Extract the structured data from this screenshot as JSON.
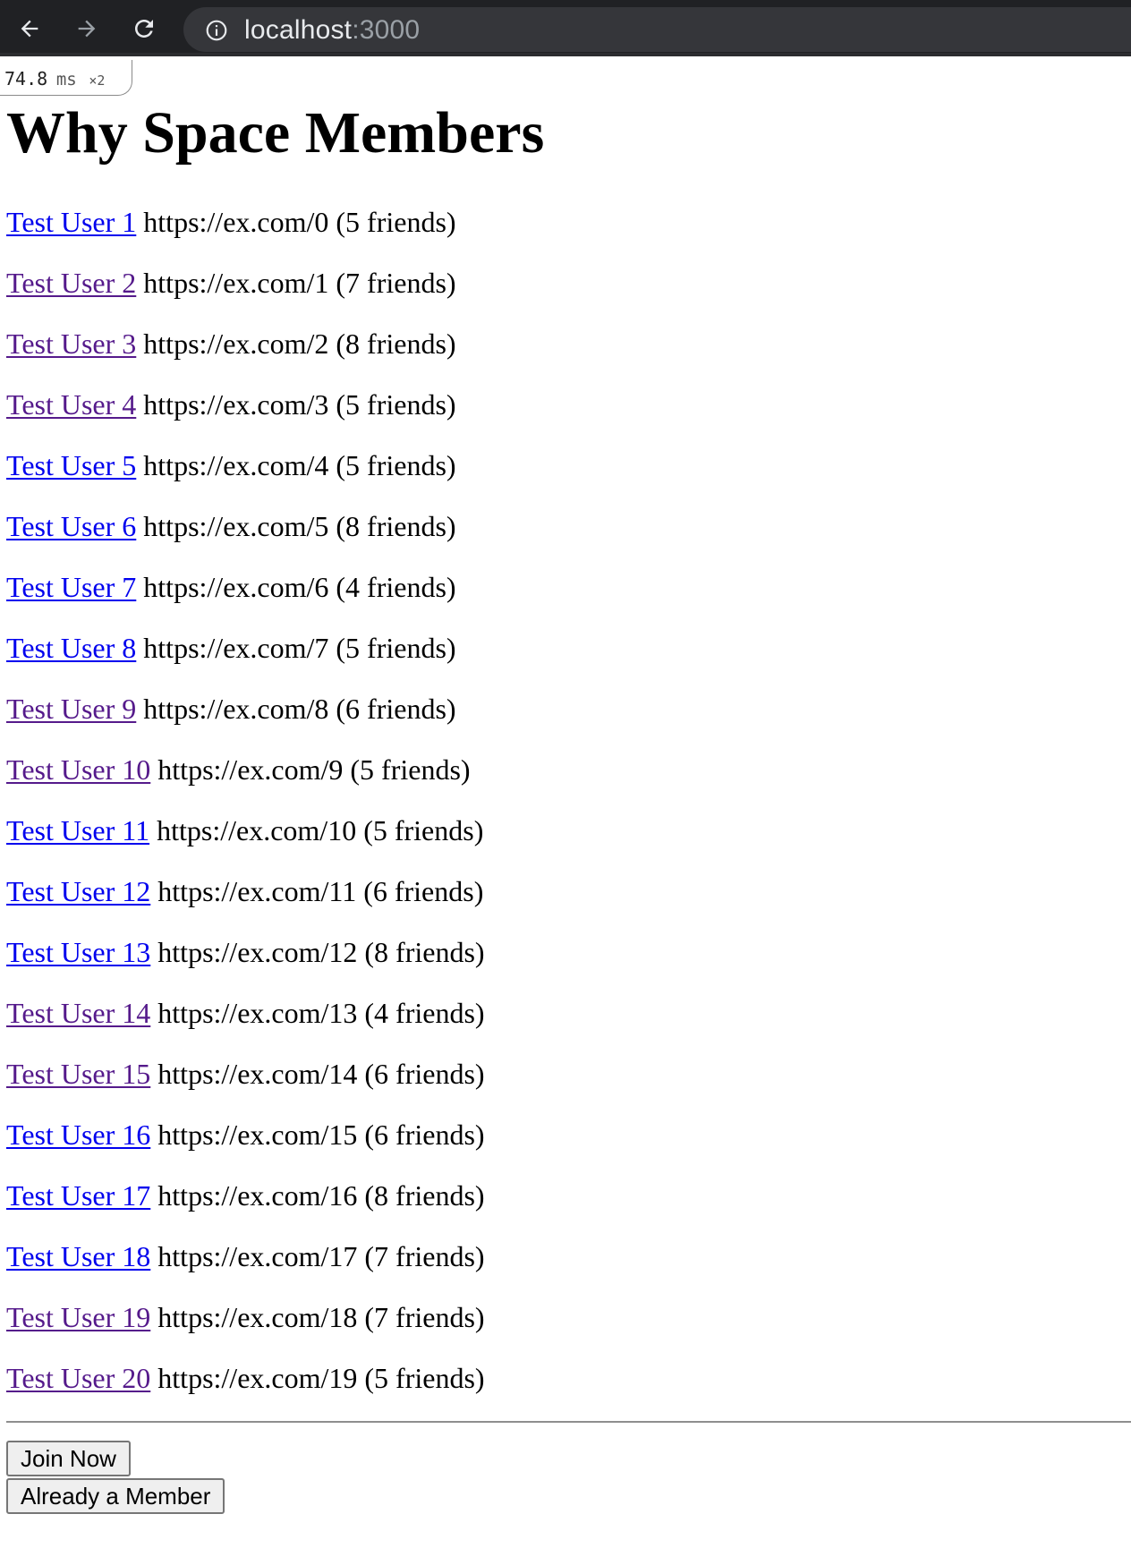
{
  "browser": {
    "url_host": "localhost",
    "url_port": ":3000",
    "icons": {
      "back": "arrow-left-icon",
      "forward": "arrow-right-icon",
      "reload": "reload-icon",
      "info": "info-circle-icon"
    }
  },
  "timing": {
    "value": "74.8",
    "unit": "ms",
    "multiplier": "×2"
  },
  "page": {
    "title": "Why Space Members"
  },
  "members": [
    {
      "name": "Test User 1",
      "url": "https://ex.com/0",
      "friends": "(5 friends)",
      "visited": false
    },
    {
      "name": "Test User 2",
      "url": "https://ex.com/1",
      "friends": "(7 friends)",
      "visited": true
    },
    {
      "name": "Test User 3",
      "url": "https://ex.com/2",
      "friends": "(8 friends)",
      "visited": true
    },
    {
      "name": "Test User 4",
      "url": "https://ex.com/3",
      "friends": "(5 friends)",
      "visited": true
    },
    {
      "name": "Test User 5",
      "url": "https://ex.com/4",
      "friends": "(5 friends)",
      "visited": false
    },
    {
      "name": "Test User 6",
      "url": "https://ex.com/5",
      "friends": "(8 friends)",
      "visited": false
    },
    {
      "name": "Test User 7",
      "url": "https://ex.com/6",
      "friends": "(4 friends)",
      "visited": false
    },
    {
      "name": "Test User 8",
      "url": "https://ex.com/7",
      "friends": "(5 friends)",
      "visited": false
    },
    {
      "name": "Test User 9",
      "url": "https://ex.com/8",
      "friends": "(6 friends)",
      "visited": true
    },
    {
      "name": "Test User 10",
      "url": "https://ex.com/9",
      "friends": "(5 friends)",
      "visited": true
    },
    {
      "name": "Test User 11",
      "url": "https://ex.com/10",
      "friends": "(5 friends)",
      "visited": false
    },
    {
      "name": "Test User 12",
      "url": "https://ex.com/11",
      "friends": "(6 friends)",
      "visited": false
    },
    {
      "name": "Test User 13",
      "url": "https://ex.com/12",
      "friends": "(8 friends)",
      "visited": false
    },
    {
      "name": "Test User 14",
      "url": "https://ex.com/13",
      "friends": "(4 friends)",
      "visited": true
    },
    {
      "name": "Test User 15",
      "url": "https://ex.com/14",
      "friends": "(6 friends)",
      "visited": true
    },
    {
      "name": "Test User 16",
      "url": "https://ex.com/15",
      "friends": "(6 friends)",
      "visited": false
    },
    {
      "name": "Test User 17",
      "url": "https://ex.com/16",
      "friends": "(8 friends)",
      "visited": false
    },
    {
      "name": "Test User 18",
      "url": "https://ex.com/17",
      "friends": "(7 friends)",
      "visited": false
    },
    {
      "name": "Test User 19",
      "url": "https://ex.com/18",
      "friends": "(7 friends)",
      "visited": true
    },
    {
      "name": "Test User 20",
      "url": "https://ex.com/19",
      "friends": "(5 friends)",
      "visited": true
    }
  ],
  "actions": {
    "join_label": "Join Now",
    "member_label": "Already a Member"
  },
  "colors": {
    "link_unvisited": "#0000ee",
    "link_visited": "#551a8b",
    "chrome_dark": "#202124"
  }
}
